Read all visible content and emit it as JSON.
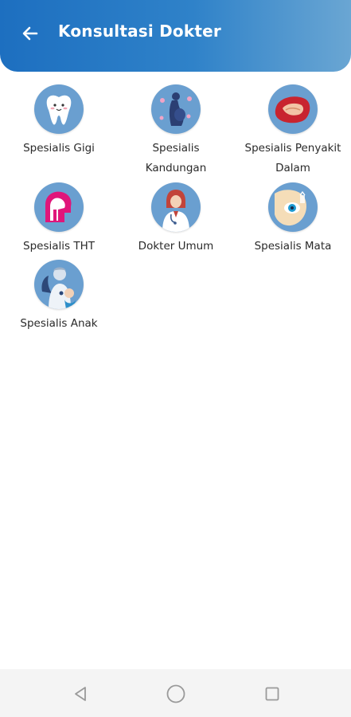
{
  "header": {
    "title": "Konsultasi Dokter",
    "back_icon": "arrow-left-icon"
  },
  "categories": [
    {
      "label": "Spesialis Gigi",
      "icon": "tooth-icon"
    },
    {
      "label": "Spesialis Kandungan",
      "icon": "pregnant-woman-icon"
    },
    {
      "label": "Spesialis Penyakit Dalam",
      "icon": "internal-organ-icon"
    },
    {
      "label": "Spesialis THT",
      "icon": "ear-nose-throat-icon"
    },
    {
      "label": "Dokter Umum",
      "icon": "doctor-icon"
    },
    {
      "label": "Spesialis Mata",
      "icon": "eye-icon"
    },
    {
      "label": "Spesialis Anak",
      "icon": "pediatric-doctor-icon"
    }
  ],
  "nav": {
    "back_icon": "triangle-back-icon",
    "home_icon": "circle-home-icon",
    "recent_icon": "square-recents-icon"
  },
  "colors": {
    "header_start": "#1d6fc0",
    "header_end": "#6aa6d3",
    "icon_bg": "#6a9fd0"
  }
}
